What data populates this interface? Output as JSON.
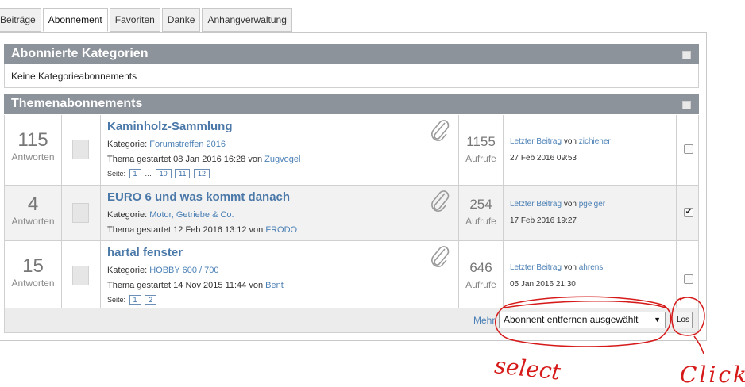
{
  "tabs": [
    "Beiträge",
    "Abonnement",
    "Favoriten",
    "Danke",
    "Anhangverwaltung"
  ],
  "active_tab_index": 1,
  "categories_section": {
    "title": "Abonnierte Kategorien",
    "empty_text": "Keine Kategorieabonnements"
  },
  "topics_section": {
    "title": "Themenabonnements"
  },
  "topics": [
    {
      "answers": "115",
      "answers_label": "Antworten",
      "title": "Kaminholz-Sammlung",
      "category_label": "Kategorie:",
      "category": "Forumstreffen 2016",
      "started_text": "Thema gestartet 08 Jan 2016 16:28 von",
      "author": "Zugvogel",
      "pages_label": "Seite:",
      "pages": [
        "1",
        "…",
        "10",
        "11",
        "12"
      ],
      "views": "1155",
      "views_label": "Aufrufe",
      "last_post_link": "Letzter Beitrag",
      "last_post_by": "von",
      "last_post_user": "zichiener",
      "last_post_date": "27 Feb 2016 09:53",
      "checked": false
    },
    {
      "answers": "4",
      "answers_label": "Antworten",
      "title": "EURO 6 und was kommt danach",
      "category_label": "Kategorie:",
      "category": "Motor, Getriebe & Co.",
      "started_text": "Thema gestartet 12 Feb 2016 13:12 von",
      "author": "FRODO",
      "views": "254",
      "views_label": "Aufrufe",
      "last_post_link": "Letzter Beitrag",
      "last_post_by": "von",
      "last_post_user": "pgeiger",
      "last_post_date": "17 Feb 2016 19:27",
      "checked": true
    },
    {
      "answers": "15",
      "answers_label": "Antworten",
      "title": "hartal fenster",
      "category_label": "Kategorie:",
      "category": "HOBBY 600 / 700",
      "started_text": "Thema gestartet 14 Nov 2015 11:44 von",
      "author": "Bent",
      "pages_label": "Seite:",
      "pages": [
        "1",
        "2"
      ],
      "views": "646",
      "views_label": "Aufrufe",
      "last_post_link": "Letzter Beitrag",
      "last_post_by": "von",
      "last_post_user": "ahrens",
      "last_post_date": "05 Jan 2016 21:30",
      "checked": false
    }
  ],
  "footer": {
    "more_label": "Mehr",
    "action_select_value": "Abonnent entfernen ausgewählt",
    "go_button": "Los"
  },
  "annotations": {
    "select_label": "select",
    "click_label": "Click",
    "color": "#d61a1a"
  }
}
